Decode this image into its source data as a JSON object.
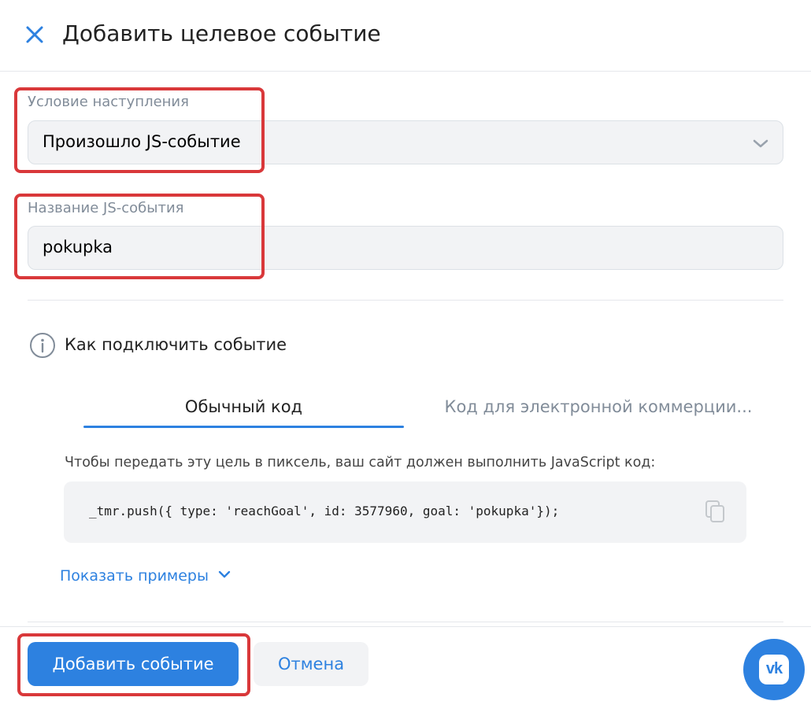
{
  "header": {
    "title": "Добавить целевое событие",
    "close_icon": "close-icon"
  },
  "condition": {
    "label": "Условие наступления",
    "value": "Произошло JS-событие",
    "icon": "chevron-down-icon"
  },
  "js_event": {
    "label": "Название JS-события",
    "value": "pokupka"
  },
  "how_to": {
    "title": "Как подключить событие",
    "icon": "info-icon",
    "tabs": [
      {
        "label": "Обычный код",
        "active": true
      },
      {
        "label": "Код для электронной коммерции...",
        "active": false
      }
    ],
    "description": "Чтобы передать эту цель в пиксель, ваш сайт должен выполнить JavaScript код:",
    "code": "_tmr.push({ type: 'reachGoal', id: 3577960, goal: 'pokupka'});",
    "copy_icon": "copy-icon",
    "show_examples": "Показать примеры"
  },
  "footer": {
    "add_label": "Добавить событие",
    "cancel_label": "Отмена",
    "vk_icon": "vk-logo-icon",
    "vk_text": "vk"
  },
  "colors": {
    "accent": "#2d81e0",
    "highlight": "#d9383a",
    "field_bg": "#f2f3f5",
    "muted_text": "#818c99"
  }
}
